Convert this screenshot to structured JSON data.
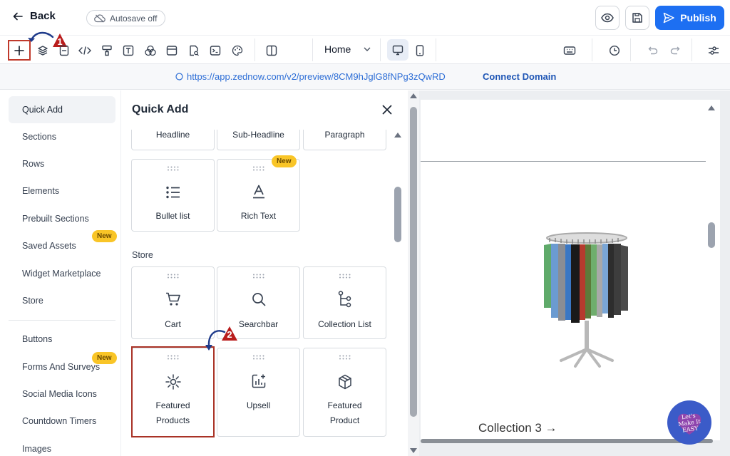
{
  "header": {
    "back_label": "Back",
    "autosave_label": "Autosave off",
    "publish_label": "Publish"
  },
  "toolbar": {
    "page_selected": "Home",
    "callout_1": "1",
    "callout_2": "2"
  },
  "urlbar": {
    "url": "https://app.zednow.com/v2/preview/8CM9hJglG8fNPg3zQwRD",
    "connect_label": "Connect Domain"
  },
  "leftnav": {
    "items": [
      {
        "label": "Quick Add"
      },
      {
        "label": "Sections"
      },
      {
        "label": "Rows"
      },
      {
        "label": "Elements"
      },
      {
        "label": "Prebuilt Sections"
      },
      {
        "label": "Saved Assets",
        "badge": "New"
      },
      {
        "label": "Widget Marketplace"
      },
      {
        "label": "Store"
      },
      {
        "label": "Buttons"
      },
      {
        "label": "Forms And Surveys",
        "badge": "New"
      },
      {
        "label": "Social Media Icons"
      },
      {
        "label": "Countdown Timers"
      },
      {
        "label": "Images"
      }
    ]
  },
  "panel": {
    "title": "Quick Add",
    "top_cards": [
      "Headline",
      "Sub-Headline",
      "Paragraph"
    ],
    "text_cards": [
      {
        "label": "Bullet list",
        "icon": "bullet-list-icon"
      },
      {
        "label": "Rich Text",
        "icon": "rich-text-icon",
        "badge": "New"
      }
    ],
    "store_section_label": "Store",
    "store_cards": [
      {
        "label": "Cart",
        "icon": "cart-icon"
      },
      {
        "label": "Searchbar",
        "icon": "search-icon"
      },
      {
        "label": "Collection List",
        "icon": "collection-list-icon"
      }
    ],
    "product_cards": [
      {
        "line1": "Featured",
        "line2": "Products",
        "icon": "featured-products-icon"
      },
      {
        "line1": "Upsell",
        "line2": "",
        "icon": "upsell-icon"
      },
      {
        "line1": "Featured",
        "line2": "Product",
        "icon": "box-icon"
      }
    ]
  },
  "canvas": {
    "collection_link": "Collection 3 →"
  },
  "watermark": {
    "text": "Let's Make It EASY"
  },
  "colors": {
    "accent": "#1d6ff2",
    "callout_red": "#c0392b",
    "badge_yellow": "#f9c527",
    "link_blue": "#2f6fd6"
  }
}
